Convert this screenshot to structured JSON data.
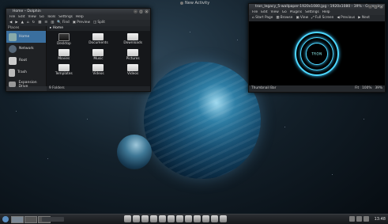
{
  "activity_label": "New Activity",
  "dolphin": {
    "title": "Home – Dolphin",
    "menu": [
      "File",
      "Edit",
      "View",
      "Go",
      "Tools",
      "Settings",
      "Help"
    ],
    "toolbar": [
      "Find",
      "Preview",
      "Split"
    ],
    "places_header": "Places",
    "places": [
      "Home",
      "Network",
      "Root",
      "Trash",
      "Expansion Drive"
    ],
    "breadcrumb": "Home",
    "files": [
      "Desktop",
      "Documents",
      "Downloads",
      "Movies",
      "Music",
      "Pictures",
      "Templates",
      "Videos",
      "Videos"
    ],
    "status": "9 Folders"
  },
  "gwenview": {
    "title": "tron_legacy_5-wallpaper-1920x1080.jpg - 1920x1080 - 39% - Gwenview",
    "menu": [
      "File",
      "Edit",
      "View",
      "Go",
      "Plugins",
      "Settings",
      "Help"
    ],
    "toolbar": [
      "Start Page",
      "Browse",
      "View",
      "Full Screen",
      "Previous",
      "Next"
    ],
    "image_label": "TRON",
    "status_left": "Thumbnail Bar",
    "status_right": [
      "Fit",
      "100%",
      "39%"
    ]
  },
  "panel": {
    "clock": "13:48"
  },
  "colors": {
    "accent": "#3a6f9f",
    "glow": "#4dd8ff"
  }
}
